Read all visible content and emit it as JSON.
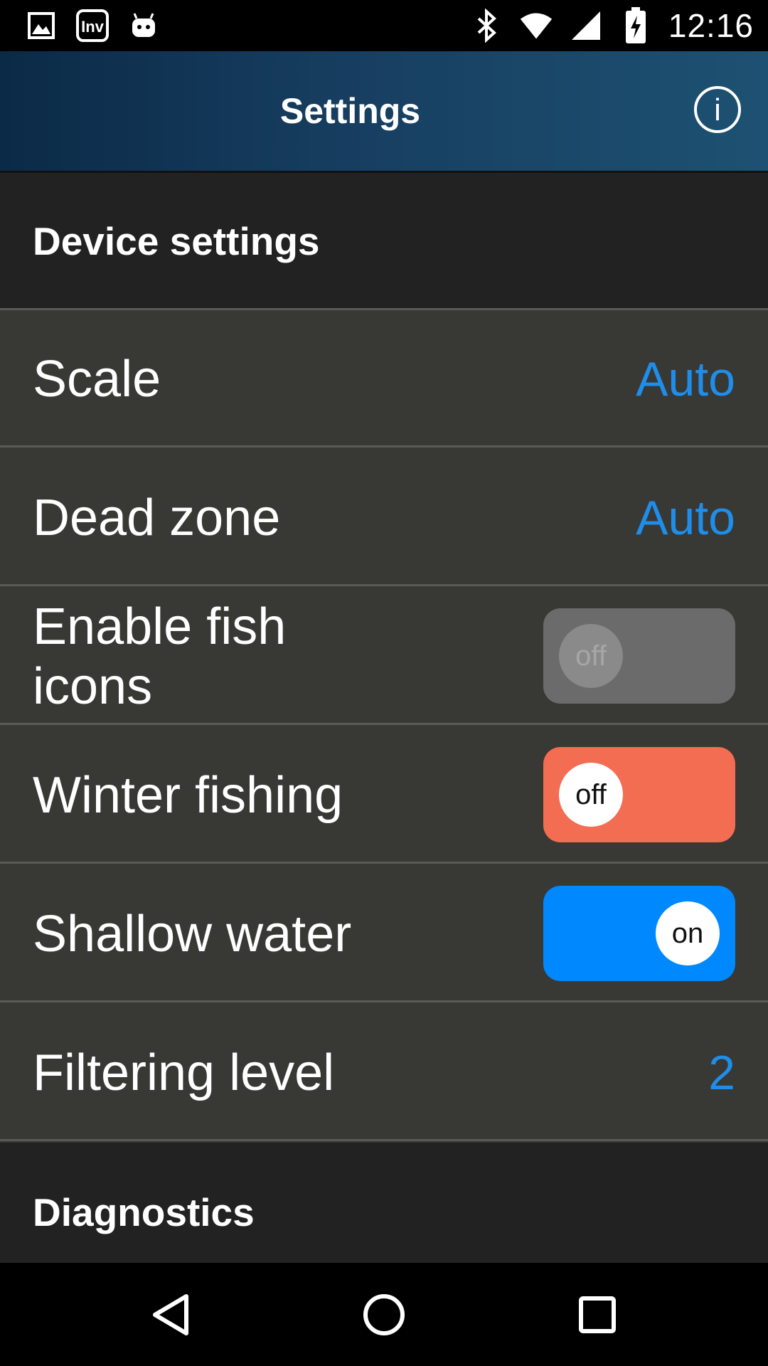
{
  "status_bar": {
    "time": "12:16",
    "left_icons": [
      "image-icon",
      "inv-app-icon",
      "android-icon"
    ],
    "right_icons": [
      "bluetooth-icon",
      "wifi-icon",
      "cell-signal-icon",
      "battery-charging-icon"
    ],
    "inv_label": "Inv"
  },
  "app_bar": {
    "title": "Settings",
    "info_icon": "info-icon",
    "info_glyph": "i"
  },
  "sections": {
    "device": {
      "title": "Device settings"
    },
    "diagnostics": {
      "title": "Diagnostics"
    }
  },
  "settings": {
    "scale": {
      "label": "Scale",
      "value": "Auto"
    },
    "dead_zone": {
      "label": "Dead zone",
      "value": "Auto"
    },
    "fish_icons": {
      "label": "Enable fish icons",
      "state": "off",
      "enabled": false
    },
    "winter_fishing": {
      "label": "Winter fishing",
      "state": "off"
    },
    "shallow_water": {
      "label": "Shallow water",
      "state": "on"
    },
    "filtering_level": {
      "label": "Filtering level",
      "value": "2"
    }
  },
  "nav_bar": {
    "icons": [
      "back-icon",
      "home-icon",
      "recents-icon"
    ]
  },
  "colors": {
    "accent_blue": "#1f8eea",
    "toggle_on": "#0088ff",
    "toggle_off": "#f26d51",
    "toggle_disabled": "#6b6b6b",
    "section_bg": "#222222",
    "row_bg": "#383835"
  }
}
